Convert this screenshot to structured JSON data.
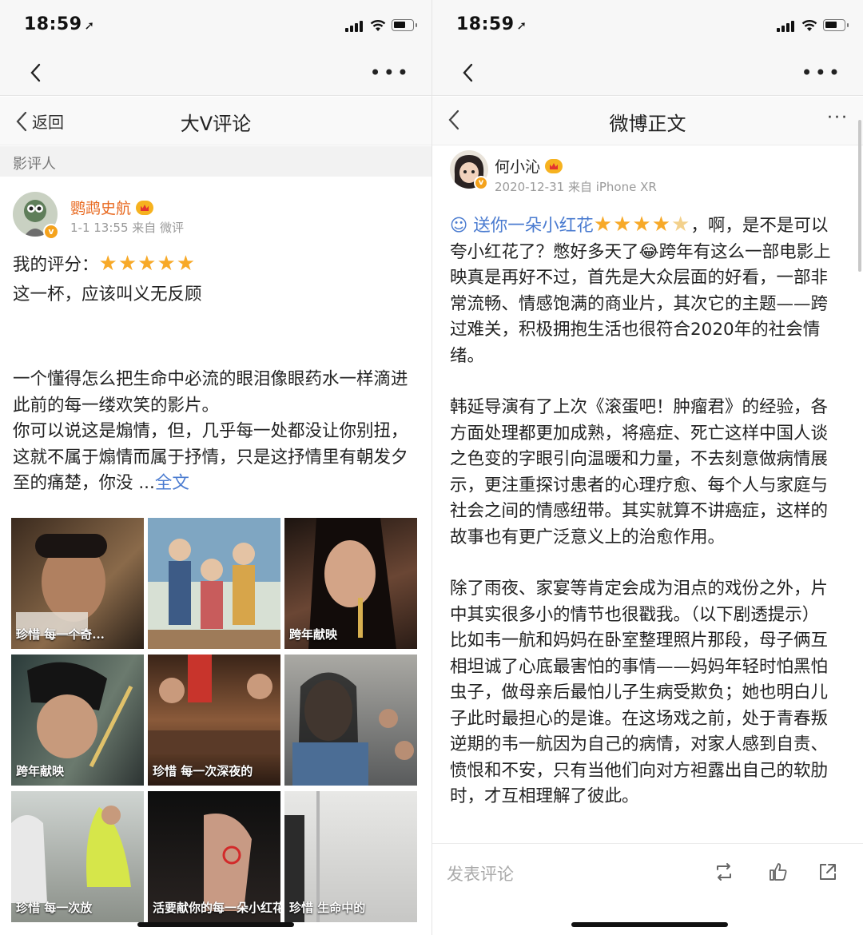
{
  "left": {
    "status": {
      "time": "18:59"
    },
    "header": {
      "back_label": "返回",
      "title": "大V评论"
    },
    "section_label": "影评人",
    "post": {
      "author": "鹦鹉史航",
      "meta": "1-1 13:55 来自 微评",
      "rating_label": "我的评分：",
      "rating_stars": 5,
      "headline": "这一杯，应该叫义无反顾",
      "paragraph_1": "一个懂得怎么把生命中必流的眼泪像眼药水一样滴进此前的每一缕欢笑的影片。",
      "paragraph_2": "你可以说这是煽情，但，几乎每一处都没让你别扭，这就不属于煽情而属于抒情，只是这抒情里有朝发夕至的痛楚，你没 ...",
      "more_link": "全文"
    },
    "images": [
      {
        "caption": "珍惜 每一个奇..."
      },
      {
        "caption": ""
      },
      {
        "caption": "跨年献映"
      },
      {
        "caption": "跨年献映"
      },
      {
        "caption": "珍惜 每一次深夜的"
      },
      {
        "caption": ""
      },
      {
        "caption": "珍惜 每一次放"
      },
      {
        "caption": "活要献你的每一朵小红花"
      },
      {
        "caption": "珍惜 生命中的"
      }
    ]
  },
  "right": {
    "status": {
      "time": "18:59"
    },
    "header": {
      "title": "微博正文",
      "more": "···"
    },
    "post": {
      "author": "何小沁",
      "meta": "2020-12-31 来自 iPhone XR",
      "topic": "送你一朵小红花",
      "rating_stars": 4.5,
      "lines_1": [
        "，啊，是不是可以",
        "夸小红花了？憋好多天了😂跨年有这么一部电影上",
        "映真是再好不过，首先是大众层面的好看，一部非",
        "常流畅、情感饱满的商业片，其次它的主题——跨",
        "过难关，积极拥抱生活也很符合2020年的社会情",
        "绪。"
      ],
      "lines_2": [
        "韩延导演有了上次《滚蛋吧！肿瘤君》的经验，各",
        "方面处理都更加成熟，将癌症、死亡这样中国人谈",
        "之色变的字眼引向温暖和力量，不去刻意做病情展",
        "示，更注重探讨患者的心理疗愈、每个人与家庭与",
        "社会之间的情感纽带。其实就算不讲癌症，这样的",
        "故事也有更广泛意义上的治愈作用。"
      ],
      "lines_3": [
        "除了雨夜、家宴等肯定会成为泪点的戏份之外，片",
        "中其实很多小的情节也很戳我。（以下剧透提示）",
        "比如韦一航和妈妈在卧室整理照片那段，母子俩互",
        "相坦诚了心底最害怕的事情——妈妈年轻时怕黑怕",
        "虫子，做母亲后最怕儿子生病受欺负；她也明白儿",
        "子此时最担心的是谁。在这场戏之前，处于青春叛",
        "逆期的韦一航因为自己的病情，对家人感到自责、",
        "愤恨和不安，只有当他们向对方袒露出自己的软肋",
        "时，才互相理解了彼此。"
      ]
    },
    "bottom": {
      "comment_placeholder": "发表评论"
    }
  },
  "colors": {
    "star": "#f7a928",
    "link": "#4a7bd0",
    "author": "#e86a21",
    "badge": "#f4a21c"
  }
}
